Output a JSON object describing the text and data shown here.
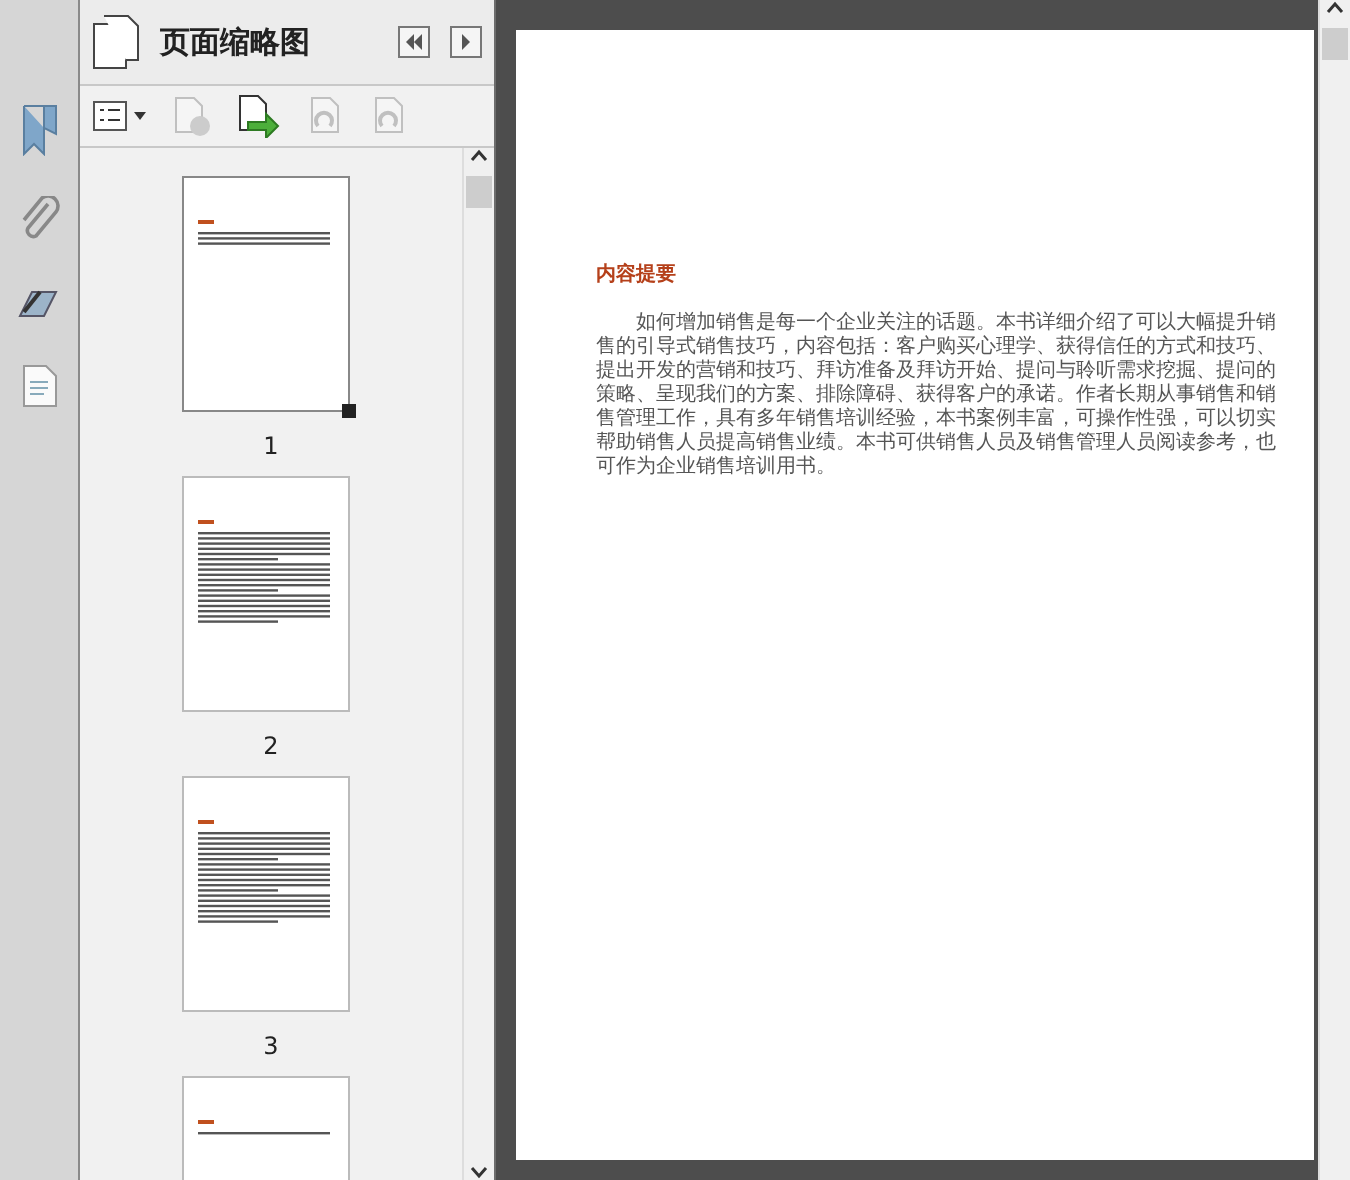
{
  "panel": {
    "title": "页面缩略图"
  },
  "rail": {
    "items": [
      {
        "kind": "bookmark",
        "selected": true
      },
      {
        "kind": "clip",
        "selected": false
      },
      {
        "kind": "sign",
        "selected": false
      },
      {
        "kind": "doc",
        "selected": false
      }
    ]
  },
  "toolbar": {
    "items": [
      {
        "kind": "options",
        "disabled": false
      },
      {
        "kind": "delete",
        "disabled": true
      },
      {
        "kind": "insert",
        "disabled": false
      },
      {
        "kind": "rotate-left",
        "disabled": true
      },
      {
        "kind": "rotate-right",
        "disabled": true
      }
    ]
  },
  "thumbnails": [
    {
      "label": "1",
      "selected": true,
      "kind": "short"
    },
    {
      "label": "2",
      "selected": false,
      "kind": "full"
    },
    {
      "label": "3",
      "selected": false,
      "kind": "full"
    },
    {
      "selected": false,
      "kind": "title"
    }
  ],
  "document": {
    "heading": "内容提要",
    "body": "如何增加销售是每一个企业关注的话题。本书详细介绍了可以大幅提升销售的引导式销售技巧，内容包括：客户购买心理学、获得信任的方式和技巧、提出开发的营销和技巧、拜访准备及拜访开始、提问与聆听需求挖掘、提问的策略、呈现我们的方案、排除障碍、获得客户的承诺。作者长期从事销售和销售管理工作，具有多年销售培训经验，本书案例丰富，可操作性强，可以切实帮助销售人员提高销售业绩。本书可供销售人员及销售管理人员阅读参考，也可作为企业销售培训用书。"
  }
}
